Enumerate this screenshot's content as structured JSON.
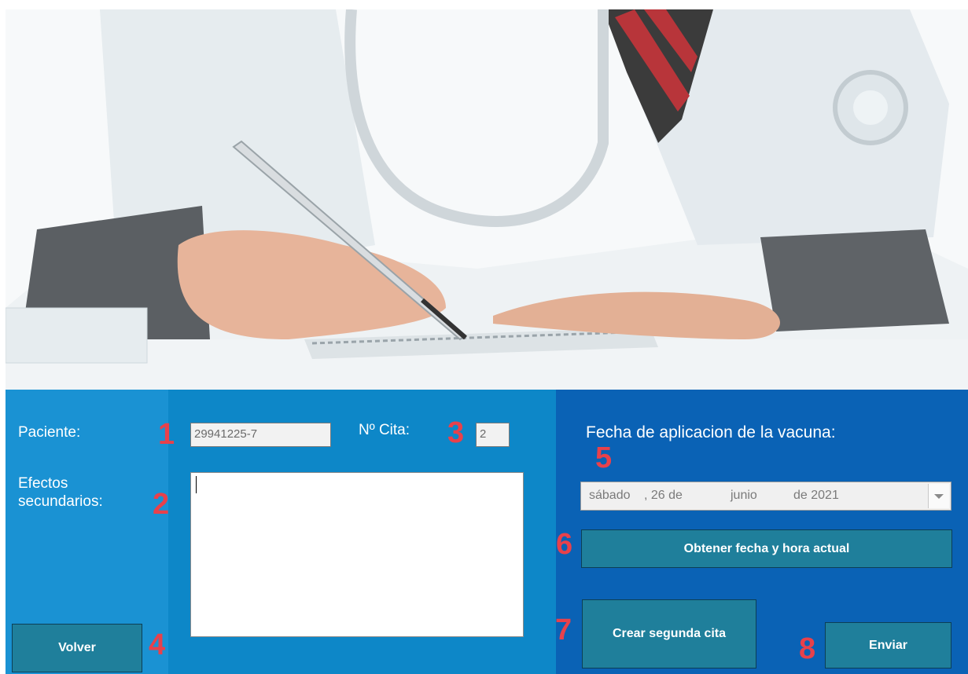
{
  "form": {
    "paciente_label": "Paciente:",
    "paciente_value": "29941225-7",
    "cita_label": "Nº Cita:",
    "cita_value": "2",
    "efectos_label": "Efectos\nsecundarios:",
    "efectos_value": "",
    "fecha_label": "Fecha de aplicacion de la vacuna:",
    "fecha_weekday": "sábado",
    "fecha_day": ", 26 de",
    "fecha_month": "junio",
    "fecha_year": "de 2021",
    "obtener_label": "Obtener fecha y hora actual",
    "volver_label": "Volver",
    "crear_label": "Crear segunda cita",
    "enviar_label": "Enviar"
  },
  "markers": [
    "1",
    "2",
    "3",
    "4",
    "5",
    "6",
    "7",
    "8"
  ],
  "colors": {
    "left_panel": "#1a92d3",
    "right_panel": "#0a62b5",
    "button": "#1f7f9b",
    "marker": "#e8414b"
  },
  "icons": {
    "dropdown": "chevron-down-icon"
  }
}
